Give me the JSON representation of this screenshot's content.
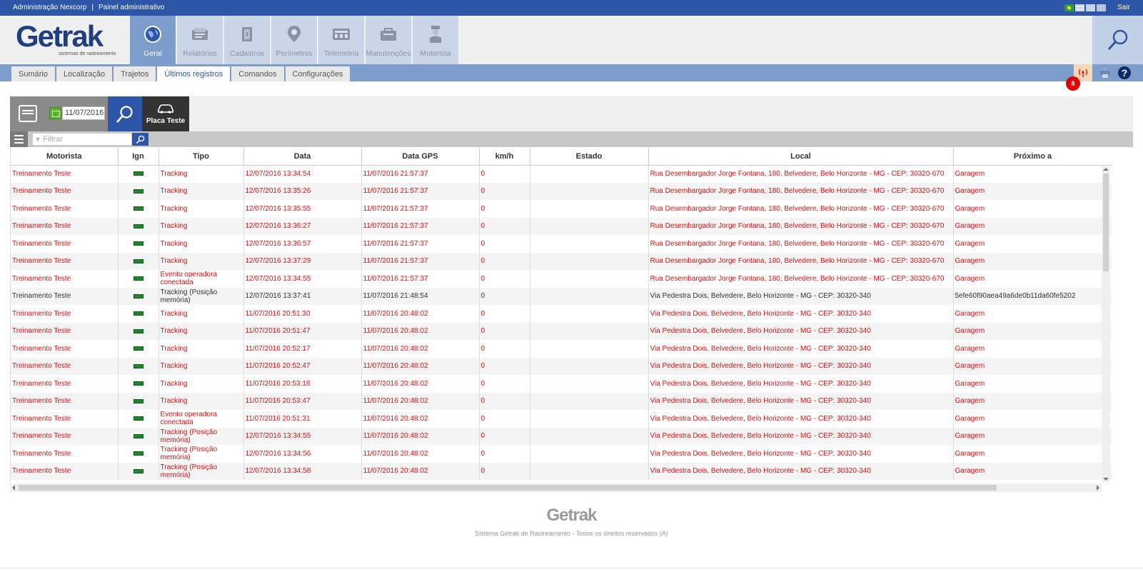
{
  "topbar": {
    "admin_link": "Administração Nexcorp",
    "separator": "|",
    "panel_link": "Painel administrativo",
    "logout": "Sair"
  },
  "logo": {
    "word": "Getrak",
    "tagline": "sistemas de rastreamento"
  },
  "mainnav": [
    {
      "label": "Geral",
      "icon": "globe-icon",
      "active": true
    },
    {
      "label": "Relatórios",
      "icon": "reports-icon",
      "active": false
    },
    {
      "label": "Cadastros",
      "icon": "registers-icon",
      "active": false
    },
    {
      "label": "Perímetros",
      "icon": "map-pin-icon",
      "active": false
    },
    {
      "label": "Telemetria",
      "icon": "telemetry-icon",
      "active": false
    },
    {
      "label": "Manutenções",
      "icon": "maintenance-icon",
      "active": false
    },
    {
      "label": "Motorista",
      "icon": "driver-icon",
      "active": false
    }
  ],
  "subtabs": [
    {
      "label": "Sumário",
      "active": false
    },
    {
      "label": "Localização",
      "active": false
    },
    {
      "label": "Trajetos",
      "active": false
    },
    {
      "label": "Últimos registros",
      "active": true
    },
    {
      "label": "Comandos",
      "active": false
    },
    {
      "label": "Configurações",
      "active": false
    }
  ],
  "alerts": {
    "count": "8"
  },
  "help_label": "?",
  "toolbar": {
    "date": "11/07/2016",
    "vehicle_label": "Placa Teste"
  },
  "filter": {
    "placeholder": "Filtrar"
  },
  "colors": {
    "accent": "#2d56a8",
    "nav_active": "#7d9dcc",
    "row_alert": "#e01010"
  },
  "table": {
    "columns": [
      "Motorista",
      "Ign",
      "Tipo",
      "Data",
      "Data GPS",
      "km/h",
      "Estado",
      "Local",
      "Próximo a"
    ],
    "rows": [
      {
        "style": "red",
        "cells": [
          "Treinamento Teste",
          "",
          "Tracking",
          "12/07/2016 13:34:54",
          "11/07/2016 21:57:37",
          "0",
          "",
          "Rua Desembargador Jorge Fontana, 180, Belvedere, Belo Horizonte - MG - CEP: 30320-670",
          "Garagem"
        ]
      },
      {
        "style": "red",
        "cells": [
          "Treinamento Teste",
          "",
          "Tracking",
          "12/07/2016 13:35:26",
          "11/07/2016 21:57:37",
          "0",
          "",
          "Rua Desembargador Jorge Fontana, 180, Belvedere, Belo Horizonte - MG - CEP: 30320-670",
          "Garagem"
        ]
      },
      {
        "style": "red",
        "cells": [
          "Treinamento Teste",
          "",
          "Tracking",
          "12/07/2016 13:35:55",
          "11/07/2016 21:57:37",
          "0",
          "",
          "Rua Desembargador Jorge Fontana, 180, Belvedere, Belo Horizonte - MG - CEP: 30320-670",
          "Garagem"
        ]
      },
      {
        "style": "red",
        "cells": [
          "Treinamento Teste",
          "",
          "Tracking",
          "12/07/2016 13:36:27",
          "11/07/2016 21:57:37",
          "0",
          "",
          "Rua Desembargador Jorge Fontana, 180, Belvedere, Belo Horizonte - MG - CEP: 30320-670",
          "Garagem"
        ]
      },
      {
        "style": "red",
        "cells": [
          "Treinamento Teste",
          "",
          "Tracking",
          "12/07/2016 13:36:57",
          "11/07/2016 21:57:37",
          "0",
          "",
          "Rua Desembargador Jorge Fontana, 180, Belvedere, Belo Horizonte - MG - CEP: 30320-670",
          "Garagem"
        ]
      },
      {
        "style": "red",
        "cells": [
          "Treinamento Teste",
          "",
          "Tracking",
          "12/07/2016 13:37:29",
          "11/07/2016 21:57:37",
          "0",
          "",
          "Rua Desembargador Jorge Fontana, 180, Belvedere, Belo Horizonte - MG - CEP: 30320-670",
          "Garagem"
        ]
      },
      {
        "style": "red",
        "cells": [
          "Treinamento Teste",
          "",
          "Evento operadora conectada",
          "12/07/2016 13:34:55",
          "11/07/2016 21:57:37",
          "0",
          "",
          "Rua Desembargador Jorge Fontana, 180, Belvedere, Belo Horizonte - MG - CEP: 30320-670",
          "Garagem"
        ]
      },
      {
        "style": "dark",
        "cells": [
          "Treinamento Teste",
          "",
          "Tracking (Posição memória)",
          "12/07/2016 13:37:41",
          "11/07/2016 21:48:54",
          "0",
          "",
          "Via Pedestra Dois, Belvedere, Belo Horizonte - MG - CEP: 30320-340",
          "5efe60f90aea49a6de0b11da60fe5202"
        ]
      },
      {
        "style": "red",
        "cells": [
          "Treinamento Teste",
          "",
          "Tracking",
          "11/07/2016 20:51:30",
          "11/07/2016 20:48:02",
          "0",
          "",
          "Via Pedestra Dois, Belvedere, Belo Horizonte - MG - CEP: 30320-340",
          "Garagem"
        ]
      },
      {
        "style": "red",
        "cells": [
          "Treinamento Teste",
          "",
          "Tracking",
          "11/07/2016 20:51:47",
          "11/07/2016 20:48:02",
          "0",
          "",
          "Via Pedestra Dois, Belvedere, Belo Horizonte - MG - CEP: 30320-340",
          "Garagem"
        ]
      },
      {
        "style": "red",
        "cells": [
          "Treinamento Teste",
          "",
          "Tracking",
          "11/07/2016 20:52:17",
          "11/07/2016 20:48:02",
          "0",
          "",
          "Via Pedestra Dois, Belvedere, Belo Horizonte - MG - CEP: 30320-340",
          "Garagem"
        ]
      },
      {
        "style": "red",
        "cells": [
          "Treinamento Teste",
          "",
          "Tracking",
          "11/07/2016 20:52:47",
          "11/07/2016 20:48:02",
          "0",
          "",
          "Via Pedestra Dois, Belvedere, Belo Horizonte - MG - CEP: 30320-340",
          "Garagem"
        ]
      },
      {
        "style": "red",
        "cells": [
          "Treinamento Teste",
          "",
          "Tracking",
          "11/07/2016 20:53:18",
          "11/07/2016 20:48:02",
          "0",
          "",
          "Via Pedestra Dois, Belvedere, Belo Horizonte - MG - CEP: 30320-340",
          "Garagem"
        ]
      },
      {
        "style": "red",
        "cells": [
          "Treinamento Teste",
          "",
          "Tracking",
          "11/07/2016 20:53:47",
          "11/07/2016 20:48:02",
          "0",
          "",
          "Via Pedestra Dois, Belvedere, Belo Horizonte - MG - CEP: 30320-340",
          "Garagem"
        ]
      },
      {
        "style": "red",
        "cells": [
          "Treinamento Teste",
          "",
          "Evento operadora conectada",
          "11/07/2016 20:51:31",
          "11/07/2016 20:48:02",
          "0",
          "",
          "Via Pedestra Dois, Belvedere, Belo Horizonte - MG - CEP: 30320-340",
          "Garagem"
        ]
      },
      {
        "style": "red",
        "cells": [
          "Treinamento Teste",
          "",
          "Tracking (Posição memória)",
          "12/07/2016 13:34:55",
          "11/07/2016 20:48:02",
          "0",
          "",
          "Via Pedestra Dois, Belvedere, Belo Horizonte - MG - CEP: 30320-340",
          "Garagem"
        ]
      },
      {
        "style": "red",
        "cells": [
          "Treinamento Teste",
          "",
          "Tracking (Posição memória)",
          "12/07/2016 13:34:56",
          "11/07/2016 20:48:02",
          "0",
          "",
          "Via Pedestra Dois, Belvedere, Belo Horizonte - MG - CEP: 30320-340",
          "Garagem"
        ]
      },
      {
        "style": "red",
        "cells": [
          "Treinamento Teste",
          "",
          "Tracking (Posição memória)",
          "12/07/2016 13:34:58",
          "11/07/2016 20:48:02",
          "0",
          "",
          "Via Pedestra Dois, Belvedere, Belo Horizonte - MG - CEP: 30320-340",
          "Garagem"
        ]
      }
    ]
  },
  "footer": {
    "logo": "Getrak",
    "copyright": "Sistema Getrak de Rastreamento - Todos os direitos reservados (A)"
  }
}
